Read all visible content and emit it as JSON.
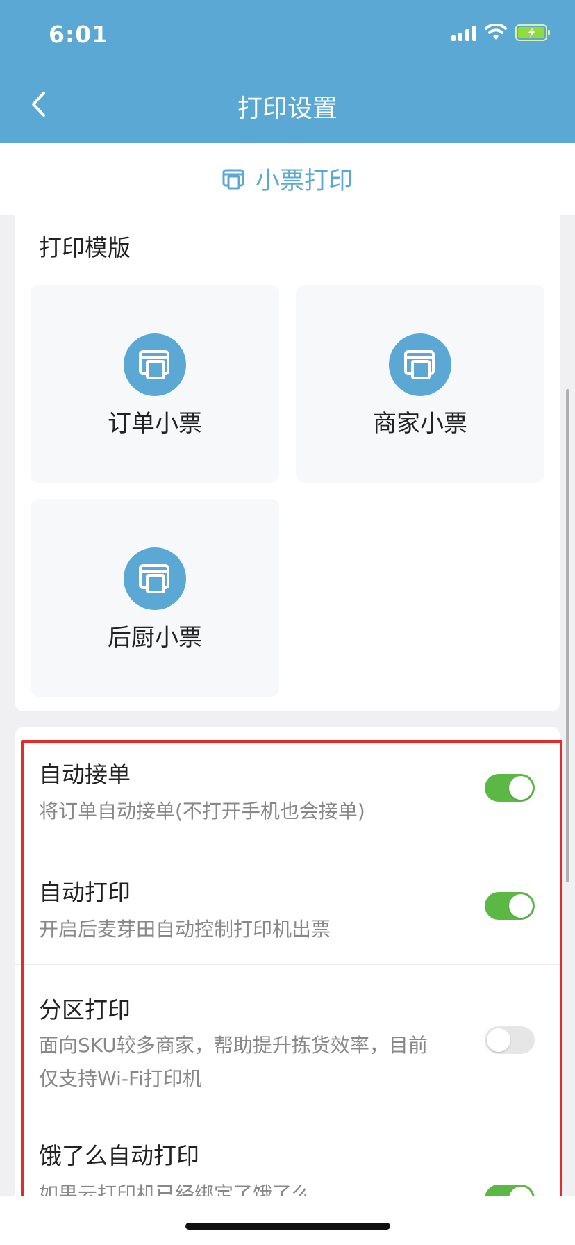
{
  "status_bar": {
    "time": "6:01",
    "icons": [
      "signal-icon",
      "wifi-icon",
      "battery-charging-icon"
    ]
  },
  "nav": {
    "title": "打印设置",
    "back_icon": "chevron-left-icon"
  },
  "tab": {
    "label": "小票打印",
    "icon": "printer-icon"
  },
  "templates": {
    "title": "打印模版",
    "items": [
      {
        "label": "订单小票",
        "icon": "printer-icon"
      },
      {
        "label": "商家小票",
        "icon": "printer-icon"
      },
      {
        "label": "后厨小票",
        "icon": "printer-icon"
      }
    ]
  },
  "settings": [
    {
      "title": "自动接单",
      "desc": "将订单自动接单(不打开手机也会接单)",
      "enabled": true
    },
    {
      "title": "自动打印",
      "desc": "开启后麦芽田自动控制打印机出票",
      "enabled": true
    },
    {
      "title": "分区打印",
      "desc_line1": "面向SKU较多商家，帮助提升拣货效率，目前",
      "desc_line2": "仅支持Wi-Fi打印机",
      "enabled": false
    },
    {
      "title": "饿了么自动打印",
      "desc": "如果云打印机已经绑定了饿了么",
      "enabled": true
    }
  ],
  "colors": {
    "header": "#5aa8d3",
    "accent": "#5aa8d3",
    "toggle_on": "#5cb845",
    "toggle_off": "#e6e6e6",
    "highlight": "#e52a2a"
  }
}
